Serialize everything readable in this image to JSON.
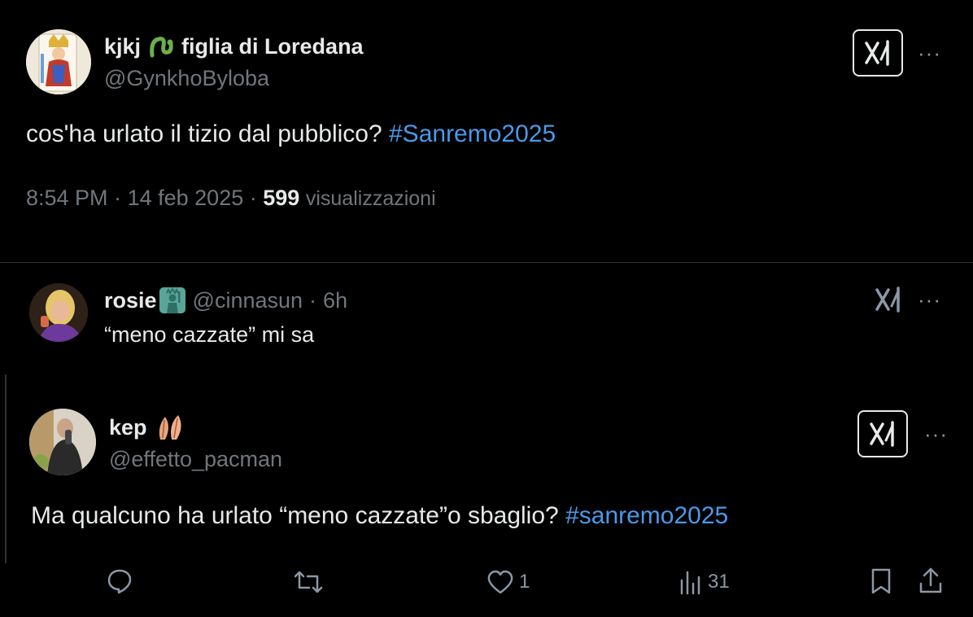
{
  "colors": {
    "background": "#000000",
    "text": "#e7e9ea",
    "muted": "#71767b",
    "link": "#4a99e9",
    "divider": "#2f3336"
  },
  "main_post": {
    "display_name_part1": "kjkj",
    "display_name_part2": "figlia di Loredana",
    "handle": "@GynkhoByloba",
    "text": "cos'ha urlato il tizio dal pubblico?",
    "hashtag": "#Sanremo2025",
    "time": "8:54 PM",
    "separator": "·",
    "date": "14 feb 2025",
    "views_count": "599",
    "views_label": "visualizzazioni",
    "avatar_icon": "king-card-avatar",
    "emoji_icon": "snake-icon"
  },
  "reply": {
    "display_name": "rosie",
    "handle": "@cinnasun",
    "separator": "·",
    "age": "6h",
    "text": "“meno cazzate” mi sa",
    "emoji_icon": "statue-of-liberty-icon"
  },
  "quoted_post": {
    "display_name": "kep",
    "handle": "@effetto_pacman",
    "text": "Ma qualcuno ha urlato “meno cazzate”o sbaglio?",
    "hashtag": "#sanremo2025",
    "emoji_icon": "leaves-icon",
    "actions": {
      "reply_icon": "reply-icon",
      "repost_icon": "repost-icon",
      "like_icon": "heart-icon",
      "like_count": "1",
      "views_icon": "analytics-icon",
      "views_count": "31",
      "bookmark_icon": "bookmark-icon",
      "share_icon": "share-icon"
    }
  },
  "more_label": "···"
}
